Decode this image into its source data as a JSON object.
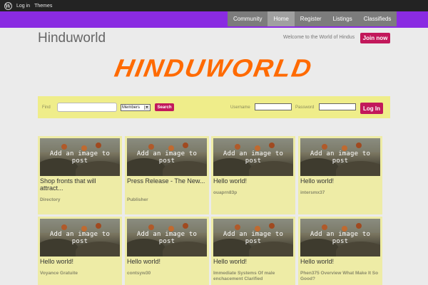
{
  "adminbar": {
    "logo_icon": "wordpress-icon",
    "links": [
      "Log in",
      "Themes"
    ]
  },
  "nav": {
    "items": [
      {
        "label": "Community",
        "active": false
      },
      {
        "label": "Home",
        "active": true
      },
      {
        "label": "Register",
        "active": false
      },
      {
        "label": "Listings",
        "active": false
      },
      {
        "label": "Classifieds",
        "active": false
      }
    ],
    "band_color": "#8a2be2"
  },
  "header": {
    "site_title": "Hinduworld",
    "welcome": "Welcome to the World of Hindus",
    "join_label": "Join now",
    "logo_text": "HINDUWORLD",
    "logo_color": "#ff6a00"
  },
  "search": {
    "find_label": "Find",
    "find_value": "",
    "select_value": "Members",
    "search_label": "Search",
    "username_label": "Username",
    "username_value": "",
    "password_label": "Password",
    "password_value": "",
    "login_label": "Log In"
  },
  "accent_color": "#c2185b",
  "cards": [
    {
      "overlay": "Add an image to post",
      "title": "Shop fronts that will attract...",
      "meta": "Directory"
    },
    {
      "overlay": "Add an image to post",
      "title": "Press Release - The New...",
      "meta": "Publisher"
    },
    {
      "overlay": "Add an image to post",
      "title": "Hello world!",
      "meta": "ouaprn83p"
    },
    {
      "overlay": "Add an image to post",
      "title": "Hello world!",
      "meta": "intersmx37"
    },
    {
      "overlay": "Add an image to post",
      "title": "Hello world!",
      "meta": "Voyance Gratuite"
    },
    {
      "overlay": "Add an image to post",
      "title": "Hello world!",
      "meta": "contsyw30"
    },
    {
      "overlay": "Add an image to post",
      "title": "Hello world!",
      "meta": "Immediate Systems Of male enchacement Clarified"
    },
    {
      "overlay": "Add an image to post",
      "title": "Hello world!",
      "meta": "Phen375 Overview What Make It So Good?"
    }
  ]
}
